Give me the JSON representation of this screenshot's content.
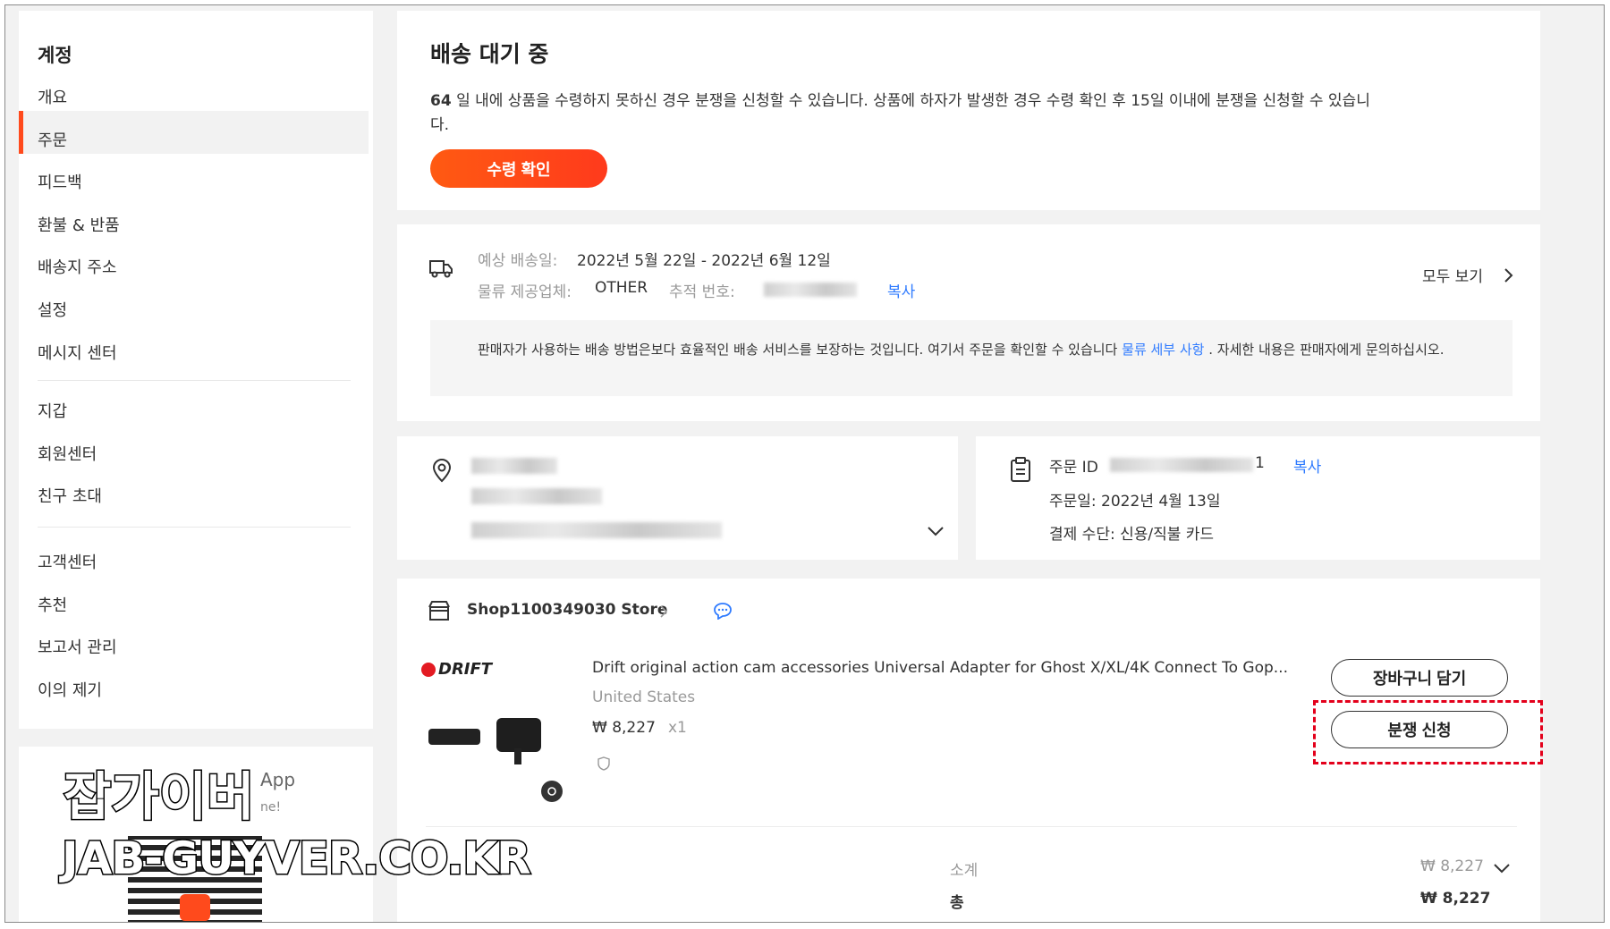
{
  "sidebar": {
    "title": "계정",
    "items": [
      "개요",
      "주문",
      "피드백",
      "환불 & 반품",
      "배송지 주소",
      "설정",
      "메시지 센터",
      "지갑",
      "회원센터",
      "친구 초대",
      "고객센터",
      "추천",
      "보고서 관리",
      "이의 제기"
    ],
    "active": "주문",
    "app_label": "App",
    "app_sub": "ne!"
  },
  "status": {
    "title": "배송 대기 중",
    "message_line1": "64 일 내에 상품을 수령하지 못하신 경우 분쟁을 신청할 수 있습니다. 상품에 하자가 발생한 경우 수령 확인 후 15일 이내에 분쟁을 신청할 수 있습니",
    "message_line2": "다.",
    "days_bold": "64",
    "confirm_button": "수령 확인"
  },
  "shipping": {
    "eta_label": "예상 배송일:",
    "eta_value": "2022년 5월 22일 - 2022년 6월 12일",
    "carrier_label": "물류 제공업체:",
    "carrier_value": "OTHER",
    "tracking_label": "추적 번호:",
    "copy": "복사",
    "view_all": "모두 보기",
    "notice_part1": "판매자가 사용하는 배송 방법은보다 효율적인 배송 서비스를 보장하는 것입니다. 여기서 주문을 확인할 수 있습니다 ",
    "notice_link": "물류 세부 사항",
    "notice_part2": " . 자세한 내용은 판매자에게 문의하십시오."
  },
  "order": {
    "id_label": "주문 ID",
    "id_tail": "1",
    "copy": "복사",
    "date": "주문일: 2022년 4월 13일",
    "payment": "결제 수단: 신용/직불 카드"
  },
  "store": {
    "name": "Shop1100349030 Store",
    "product_title": "Drift original action cam accessories Universal Adapter for Ghost X/XL/4K Connect To Gop...",
    "ship_from": "United States",
    "price": "₩ 8,227",
    "qty": "x1",
    "brand": "DRIFT",
    "add_cart": "장바구니 담기",
    "dispute": "분쟁 신청"
  },
  "summary": {
    "subtotal_label": "소계",
    "subtotal_value": "₩ 8,227",
    "total_label": "총",
    "total_value": "₩ 8,227"
  },
  "watermark": {
    "line1": "잡가이버",
    "line2": "JAB-GUYVER.CO.KR"
  },
  "colors": {
    "accent": "#ff4a1c",
    "link": "#2f7bff",
    "dispute_highlight": "#e3001b"
  }
}
